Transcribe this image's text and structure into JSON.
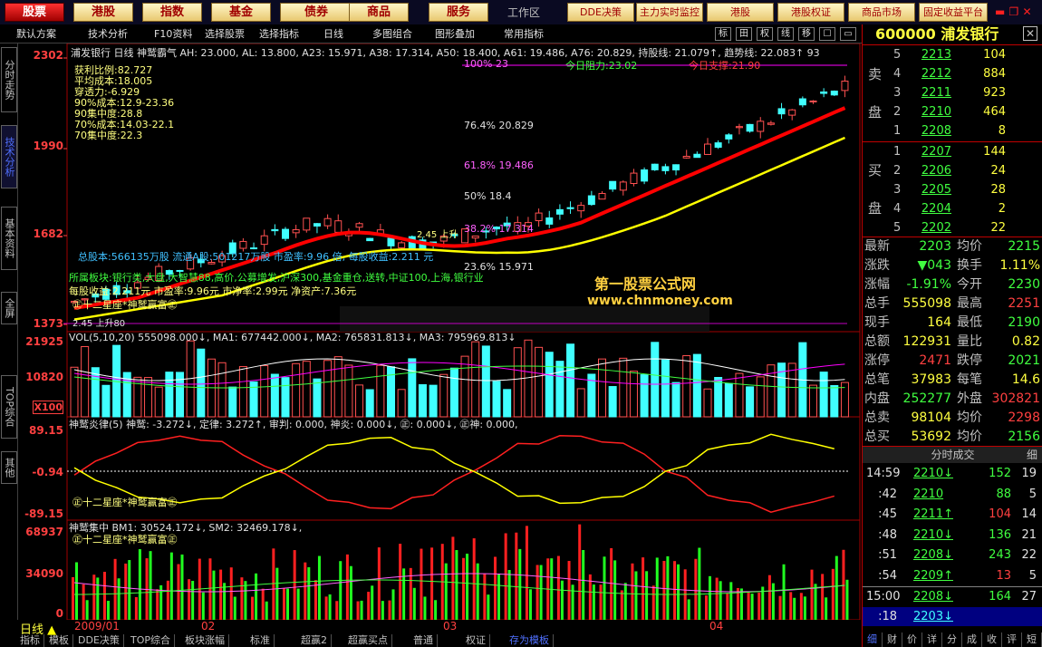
{
  "topbar": {
    "tabs": [
      "股票",
      "港股",
      "指数",
      "基金",
      "债券",
      "商品",
      "服务"
    ],
    "active_tab": "股票",
    "workspace": "工作区",
    "right_buttons": [
      "DDE决策",
      "主力实时监控",
      "港股",
      "港股权证",
      "商品市场",
      "固定收益平台"
    ],
    "window_controls": "▬ ❐ ✕"
  },
  "toolbar": {
    "items": [
      "默认方案",
      "技术分析",
      "F10资料",
      "选择股票",
      "选择指标",
      "日线",
      "多图组合",
      "图形叠加",
      "常用指标"
    ],
    "icons": [
      "标",
      "田",
      "权",
      "线",
      "移",
      "☐",
      "▭"
    ]
  },
  "left_tabs": [
    "分时走势",
    "技术分析",
    "基本资料",
    "全屏",
    "TOP综合",
    "其他"
  ],
  "left_active": "技术分析",
  "main_chart": {
    "header": "浦发银行 日线 神鹫霸气 AH: 23.000, AL: 13.800, A23: 15.971, A38: 17.314, A50: 18.400, A61: 19.486, A76: 20.829, 持股线: 21.079↑, 趋势线: 22.083↑ 93",
    "y_labels": [
      "2302",
      "1990",
      "1682",
      "1373"
    ],
    "stats": [
      "获利比例:82.727",
      "平均成本:18.005",
      "穿透力:-6.929",
      "90%成本:12.9-23.36",
      "90集中度:28.8",
      "70%成本:14.03-22.1",
      "70集中度:22.3"
    ],
    "fib_levels": [
      "100%  23",
      "76.4%  20.829",
      "61.8%  19.486",
      "50%  18.4",
      "38.2%  17.314",
      "23.6%  15.971"
    ],
    "resist": "今日阻力:23.02",
    "support": "今日支撑:21.90",
    "info1": "总股本:566135万股 流通A股:501217万股 市盈率:9.96 倍, 每股收益:2.211 元",
    "info2": "所属板块:银行类,大盘,大智慧88,高价,公募增发,沪深300,基金重仓,送转,中证100,上海,银行业",
    "info3": "每股收益:2.211元 市盈率:9.96元 市净率:2.99元 净资产:7.36元",
    "tagline": "㊣十二星座*神鹫赢富㊣",
    "tag_small": "2.45 上升",
    "tag_small2": "2.45 上升80",
    "watermark1": "第一股票公式网",
    "watermark2": "www.chnmoney.com"
  },
  "vol_panel": {
    "header": "VOL(5,10,20) 555098.000↓, MA1: 677442.000↓, MA2: 765831.813↓, MA3: 795969.813↓",
    "y_labels": [
      "21925",
      "10820",
      "X100"
    ]
  },
  "osc_panel": {
    "header": "神鹫炎律(5) 神鹫: -3.272↓, 定律: 3.272↑, 审判: 0.000, 神炎: 0.000↓, ㊣: 0.000↓, ㊣神: 0.000,",
    "y_labels": [
      "89.15",
      "-0.94",
      "-89.15"
    ],
    "tagline": "㊣十二星座*神鹫赢富㊣"
  },
  "conc_panel": {
    "header": "神鹫集中 BM1: 30524.172↓, SM2: 32469.178↓,",
    "y_labels": [
      "68937",
      "34090",
      "0"
    ],
    "tagline": "㊣十二星座*神鹫赢富㊣"
  },
  "bottom": {
    "period": "日线",
    "dates": [
      "2009/01",
      "02",
      "03",
      "04"
    ],
    "tabs": [
      "指标",
      "模板",
      "DDE决策",
      "TOP综合",
      "板块涨幅",
      "标准",
      "超赢2",
      "超赢买点",
      "普通",
      "权证",
      "存为模板"
    ],
    "active_tab": "存为模板"
  },
  "quote": {
    "code": "600000",
    "name": "浦发银行",
    "sell_label": "卖盘",
    "buy_label": "买盘",
    "sell": [
      {
        "n": "5",
        "p": "2213",
        "v": "104"
      },
      {
        "n": "4",
        "p": "2212",
        "v": "884"
      },
      {
        "n": "3",
        "p": "2211",
        "v": "923"
      },
      {
        "n": "2",
        "p": "2210",
        "v": "464"
      },
      {
        "n": "1",
        "p": "2208",
        "v": "8"
      }
    ],
    "buy": [
      {
        "n": "1",
        "p": "2207",
        "v": "144"
      },
      {
        "n": "2",
        "p": "2206",
        "v": "24"
      },
      {
        "n": "3",
        "p": "2205",
        "v": "28"
      },
      {
        "n": "4",
        "p": "2204",
        "v": "2"
      },
      {
        "n": "5",
        "p": "2202",
        "v": "22"
      }
    ],
    "stats": [
      {
        "l": "最新",
        "a": "2203",
        "l2": "均价",
        "b": "2215"
      },
      {
        "l": "涨跌",
        "a": "▼043",
        "l2": "换手",
        "b": "1.11%"
      },
      {
        "l": "涨幅",
        "a": "-1.91%",
        "l2": "今开",
        "b": "2230"
      },
      {
        "l": "总手",
        "a": "555098",
        "l2": "最高",
        "b": "2251"
      },
      {
        "l": "现手",
        "a": "164",
        "l2": "最低",
        "b": "2190"
      },
      {
        "l": "总额",
        "a": "122931",
        "l2": "量比",
        "b": "0.82"
      },
      {
        "l": "涨停",
        "a": "2471",
        "l2": "跌停",
        "b": "2021"
      },
      {
        "l": "总笔",
        "a": "37983",
        "l2": "每笔",
        "b": "14.6"
      },
      {
        "l": "内盘",
        "a": "252277",
        "l2": "外盘",
        "b": "302821"
      },
      {
        "l": "总卖",
        "a": "98104",
        "l2": "均价",
        "b": "2298"
      },
      {
        "l": "总买",
        "a": "53692",
        "l2": "均价",
        "b": "2156"
      }
    ],
    "ticks_title": "分时成交",
    "ticks_btn": "细",
    "ticks": [
      {
        "t": "14:59",
        "p": "2210",
        "arrow": "↓",
        "v": "152",
        "n": "19"
      },
      {
        "t": ":42",
        "p": "2210",
        "arrow": "",
        "v": "88",
        "n": "5"
      },
      {
        "t": ":45",
        "p": "2211",
        "arrow": "↑",
        "v": "104",
        "n": "14"
      },
      {
        "t": ":48",
        "p": "2210",
        "arrow": "↓",
        "v": "136",
        "n": "21"
      },
      {
        "t": ":51",
        "p": "2208",
        "arrow": "↓",
        "v": "243",
        "n": "22"
      },
      {
        "t": ":54",
        "p": "2209",
        "arrow": "↑",
        "v": "13",
        "n": "5"
      },
      {
        "t": "15:00",
        "p": "2208",
        "arrow": "↓",
        "v": "164",
        "n": "27"
      },
      {
        "t": ":18",
        "p": "2203",
        "arrow": "↓",
        "v": "",
        "n": ""
      }
    ],
    "bottom_tabs": [
      "细",
      "财",
      "价",
      "详",
      "分",
      "成",
      "收",
      "评",
      "短"
    ]
  },
  "colors": {
    "up": "#ff3030",
    "down": "#40ffff",
    "ma_red": "#ff0000",
    "ma_yellow": "#ffff00",
    "bg": "#000000",
    "grid": "#a00000"
  }
}
